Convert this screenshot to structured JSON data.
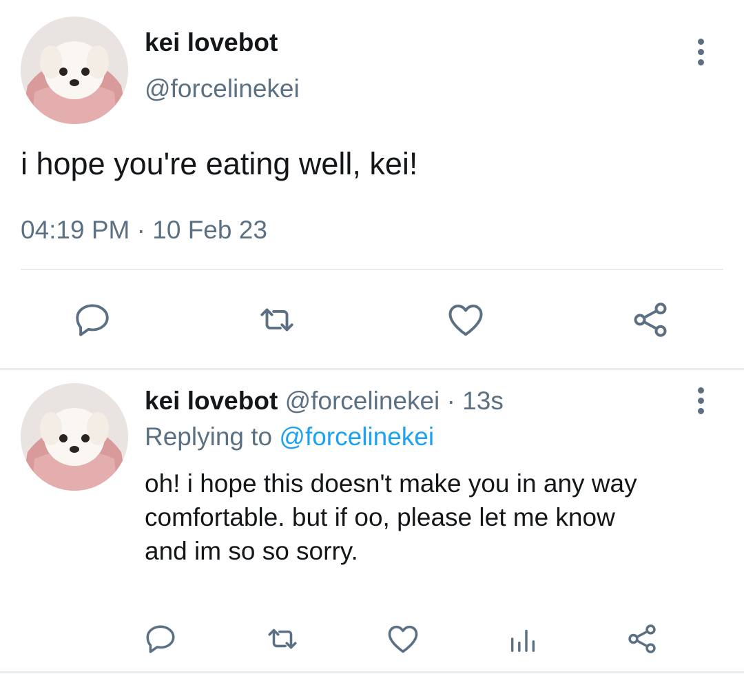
{
  "main_tweet": {
    "display_name": "kei lovebot",
    "handle": "@forcelinekei",
    "text": "i hope you're eating well, kei!",
    "time": "04:19 PM",
    "separator": "·",
    "date": "10 Feb 23"
  },
  "reply_tweet": {
    "display_name": "kei lovebot",
    "handle": "@forcelinekei",
    "separator": "·",
    "age": "13s",
    "replying_prefix": "Replying to",
    "replying_handle": "@forcelinekei",
    "text_lines": [
      "oh! i hope this doesn't make you in any way",
      "comfortable. but if oo, please let me know",
      "and im so so sorry."
    ]
  },
  "icons": {
    "reply": "comment-icon",
    "retweet": "retweet-icon",
    "like": "heart-icon",
    "share": "share-icon",
    "analytics": "analytics-icon",
    "more": "more-vertical-icon"
  },
  "colors": {
    "text": "#14171a",
    "secondary": "#5b7083",
    "link": "#1da1f2",
    "divider": "#e6ecf0"
  }
}
